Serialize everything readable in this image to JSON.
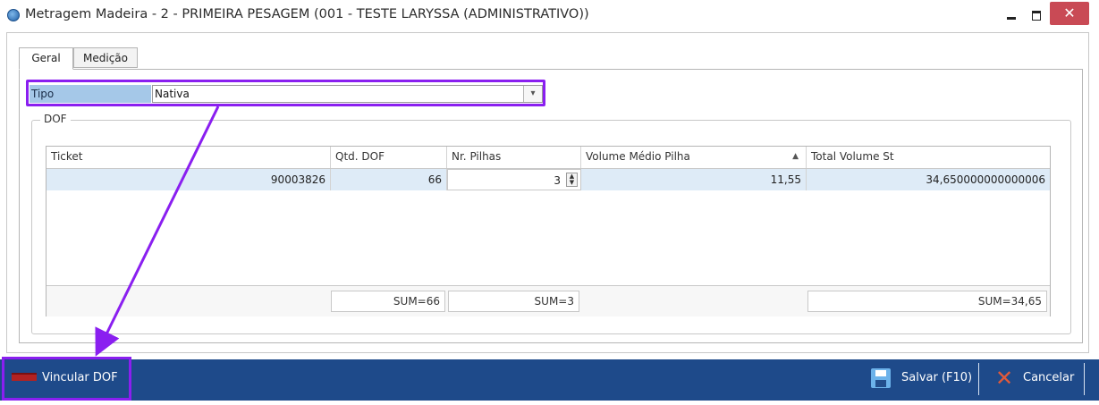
{
  "window": {
    "title": "Metragem Madeira - 2 - PRIMEIRA  PESAGEM (001 - TESTE LARYSSA (ADMINISTRATIVO))",
    "close_glyph": "✕"
  },
  "tabs": [
    {
      "label": "Geral",
      "active": true
    },
    {
      "label": "Medição",
      "active": false
    }
  ],
  "tipo": {
    "label": "Tipo",
    "value": "Nativa",
    "dropdown_glyph": "▾"
  },
  "dof": {
    "legend": "DOF",
    "columns": [
      "Ticket",
      "Qtd. DOF",
      "Nr. Pilhas",
      "Volume Médio Pilha",
      "Total Volume St"
    ],
    "sort_glyph": "▲",
    "rows": [
      {
        "ticket": "90003826",
        "qtd_dof": "66",
        "nr_pilhas": "3",
        "volume_medio_pilha": "11,55",
        "total_volume_st": "34,650000000000006"
      }
    ],
    "footer": {
      "qtd_dof": "SUM=66",
      "nr_pilhas": "SUM=3",
      "total_volume_st": "SUM=34,65"
    }
  },
  "toolbar": {
    "vincular_label": "Vincular DOF",
    "save_label": "Salvar (F10)",
    "cancel_label": "Cancelar",
    "cancel_glyph": "✕"
  },
  "colors": {
    "toolbar_bg": "#1e4a8a",
    "highlight": "#8a1ff0",
    "selected_row": "#deebf7",
    "close_button": "#c94a55"
  }
}
